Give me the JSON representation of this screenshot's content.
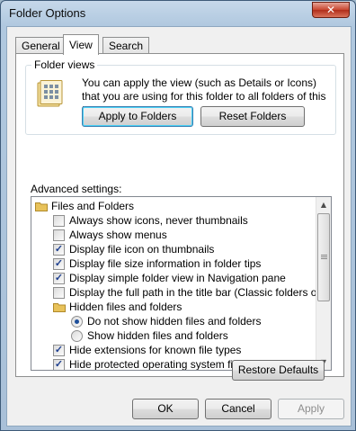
{
  "window": {
    "title": "Folder Options",
    "close_glyph": "✕"
  },
  "tabs": [
    {
      "label": "General"
    },
    {
      "label": "View"
    },
    {
      "label": "Search"
    }
  ],
  "folder_views": {
    "label": "Folder views",
    "description": "You can apply the view (such as Details or Icons) that you are using for this folder to all folders of this type.",
    "apply_label": "Apply to Folders",
    "reset_label": "Reset Folders"
  },
  "advanced": {
    "label": "Advanced settings:",
    "items": [
      {
        "kind": "folder",
        "label": "Files and Folders"
      },
      {
        "kind": "checkbox",
        "label": "Always show icons, never thumbnails",
        "checked": false
      },
      {
        "kind": "checkbox",
        "label": "Always show menus",
        "checked": false
      },
      {
        "kind": "checkbox",
        "label": "Display file icon on thumbnails",
        "checked": true
      },
      {
        "kind": "checkbox",
        "label": "Display file size information in folder tips",
        "checked": true
      },
      {
        "kind": "checkbox",
        "label": "Display simple folder view in Navigation pane",
        "checked": true
      },
      {
        "kind": "checkbox",
        "label": "Display the full path in the title bar (Classic folders only)",
        "checked": false
      },
      {
        "kind": "folder",
        "label": "Hidden files and folders"
      },
      {
        "kind": "radio",
        "label": "Do not show hidden files and folders",
        "checked": true
      },
      {
        "kind": "radio",
        "label": "Show hidden files and folders",
        "checked": false
      },
      {
        "kind": "checkbox",
        "label": "Hide extensions for known file types",
        "checked": true
      },
      {
        "kind": "checkbox",
        "label": "Hide protected operating system files (Recommended)",
        "checked": true
      }
    ]
  },
  "restore_label": "Restore Defaults",
  "footer": {
    "ok_label": "OK",
    "cancel_label": "Cancel",
    "apply_label": "Apply"
  },
  "icons": {
    "check": "✓",
    "scroll_up": "▲",
    "scroll_down": "▼"
  },
  "colors": {
    "accent": "#3c7fb1",
    "folder": "#e8c25a",
    "check": "#1d3e8e"
  }
}
